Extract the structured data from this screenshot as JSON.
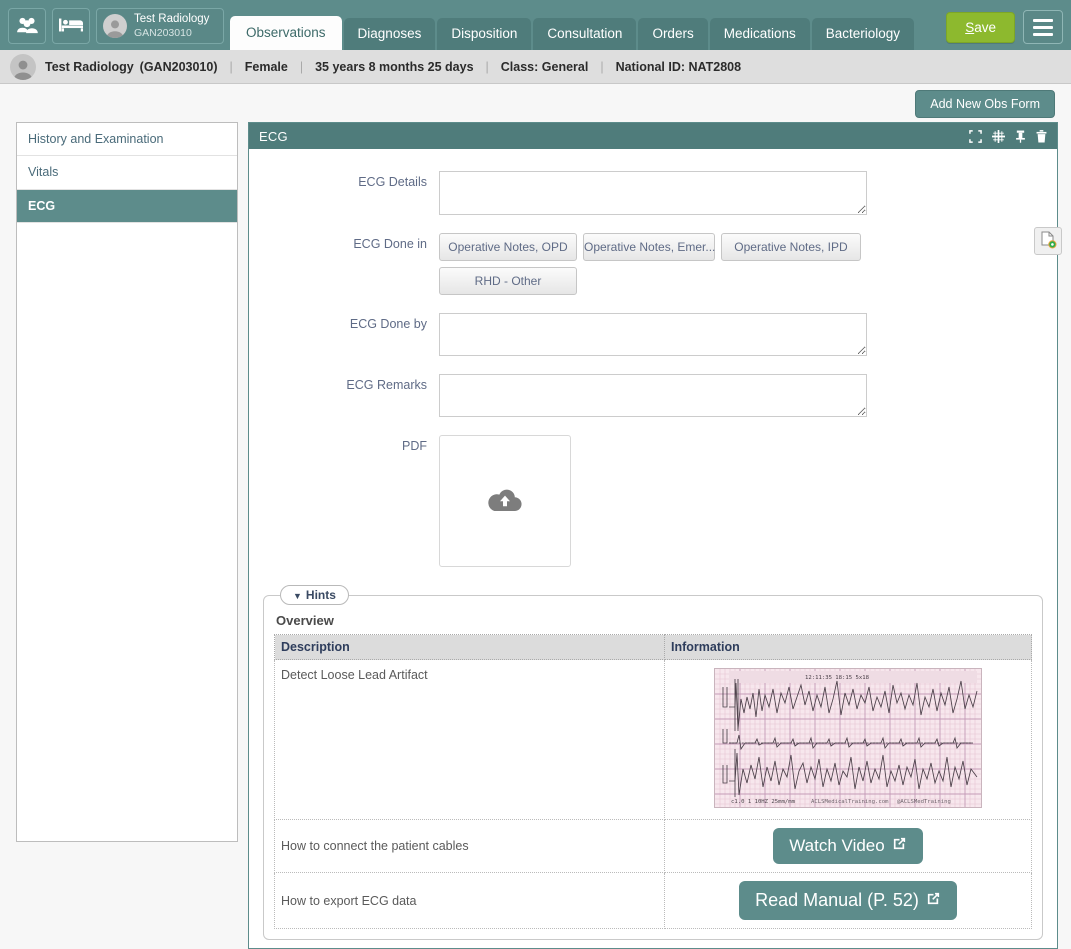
{
  "navbar": {
    "patients_icon": "people-icon",
    "beds_icon": "bed-icon",
    "patient_chip": {
      "name": "Test Radiology",
      "id": "GAN203010"
    },
    "tabs": [
      {
        "label": "Observations",
        "active": true
      },
      {
        "label": "Diagnoses",
        "active": false
      },
      {
        "label": "Disposition",
        "active": false
      },
      {
        "label": "Consultation",
        "active": false
      },
      {
        "label": "Orders",
        "active": false
      },
      {
        "label": "Medications",
        "active": false
      },
      {
        "label": "Bacteriology",
        "active": false
      }
    ],
    "save_label_prefix": "S",
    "save_label_rest": "ave",
    "menu_icon": "hamburger-icon",
    "accent_teal": "#5d8c8b",
    "accent_green": "#8db92e"
  },
  "patient_bar": {
    "name": "Test Radiology",
    "id": "(GAN203010)",
    "gender": "Female",
    "age": "35 years 8 months 25 days",
    "class": "Class: General",
    "national_id": "National ID: NAT2808"
  },
  "action_bar": {
    "add_obs_form": "Add New Obs Form"
  },
  "sidebar": {
    "items": [
      {
        "label": "History and Examination",
        "active": false
      },
      {
        "label": "Vitals",
        "active": false
      },
      {
        "label": "ECG",
        "active": true
      }
    ]
  },
  "panel": {
    "title": "ECG",
    "icons": [
      "expand-icon",
      "move-icon",
      "pin-icon",
      "trash-icon"
    ],
    "rail_button_icon": "new-document-icon",
    "fields": {
      "details_label": "ECG Details",
      "details_value": "",
      "done_in_label": "ECG Done in",
      "done_in_options": [
        "Operative Notes, OPD",
        "Operative Notes, Emer...",
        "Operative Notes, IPD",
        "RHD - Other"
      ],
      "done_by_label": "ECG Done by",
      "done_by_value": "",
      "remarks_label": "ECG Remarks",
      "remarks_value": "",
      "pdf_label": "PDF",
      "pdf_dropzone_icon": "cloud-upload-icon"
    }
  },
  "hints": {
    "legend": "Hints",
    "caret": "▼",
    "overview_title": "Overview",
    "columns": [
      "Description",
      "Information"
    ],
    "rows": [
      {
        "description": "Detect Loose Lead Artifact",
        "info_type": "image",
        "info_caption": "ecg-rhythm-strip"
      },
      {
        "description": "How to connect the patient cables",
        "info_type": "button",
        "button_label": "Watch Video",
        "button_icon": "external-link-icon"
      },
      {
        "description": "How to export ECG data",
        "info_type": "button",
        "button_label": "Read Manual (P. 52)",
        "button_icon": "external-link-icon"
      }
    ]
  }
}
